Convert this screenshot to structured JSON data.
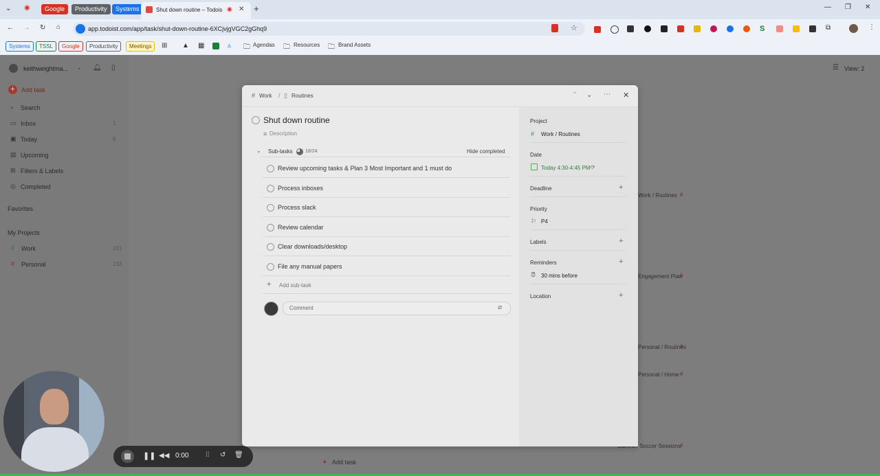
{
  "browser": {
    "tab_groups": [
      {
        "label": "Google",
        "color": "#d93025"
      },
      {
        "label": "Productivity",
        "color": "#5f6368"
      },
      {
        "label": "Systems",
        "color": "#1a73e8"
      }
    ],
    "active_tab_title": "Shut down routine – Todois",
    "url": "app.todoist.com/app/task/shut-down-routine-6XCjvjgVGC2gGhq9",
    "bookmarks": {
      "chips": [
        "Systems",
        "TSSL",
        "Google",
        "Productivity",
        "Meetings"
      ],
      "folders": [
        "Agendas",
        "Resources",
        "Brand Assets"
      ]
    }
  },
  "sidebar": {
    "account": "keithweightma...",
    "add_task": "Add task",
    "items": [
      {
        "label": "Search",
        "count": ""
      },
      {
        "label": "Inbox",
        "count": "1"
      },
      {
        "label": "Today",
        "count": "8"
      },
      {
        "label": "Upcoming",
        "count": ""
      },
      {
        "label": "Filters & Labels",
        "count": ""
      },
      {
        "label": "Completed",
        "count": ""
      }
    ],
    "favorites_heading": "Favorites",
    "projects_heading": "My Projects",
    "projects": [
      {
        "label": "Work",
        "count": "151"
      },
      {
        "label": "Personal",
        "count": "233"
      }
    ]
  },
  "main": {
    "view_label": "View: 2",
    "background_texts": [
      "Work / Routines",
      "Engagement Plan",
      "Personal / Routines",
      "Personal / Home",
      "Summer Soccer Sessions",
      "Add task"
    ]
  },
  "task": {
    "breadcrumb_project": "Work",
    "breadcrumb_section": "Routines",
    "title": "Shut down routine",
    "description_placeholder": "Description",
    "subtasks_label": "Sub-tasks",
    "subtasks_count": "18/24",
    "hide_completed": "Hide completed",
    "subtasks": [
      "Review upcoming tasks & Plan 3 Most Important and 1 must do",
      "Process inboxes",
      "Process slack",
      "Review calendar",
      "Clear downloads/desktop",
      "File any manual papers"
    ],
    "add_subtask": "Add sub-task",
    "comment_placeholder": "Comment",
    "side": {
      "project_label": "Project",
      "project_value": "Work / Routines",
      "date_label": "Date",
      "date_value": "Today 4:30-4:45 PM",
      "deadline_label": "Deadline",
      "priority_label": "Priority",
      "priority_value": "P4",
      "labels_label": "Labels",
      "reminders_label": "Reminders",
      "reminder_value": "30 mins before",
      "location_label": "Location"
    }
  },
  "recorder": {
    "time": "0:00"
  },
  "colors": {
    "accent": "#dc4c3e",
    "green": "#4caf50"
  }
}
